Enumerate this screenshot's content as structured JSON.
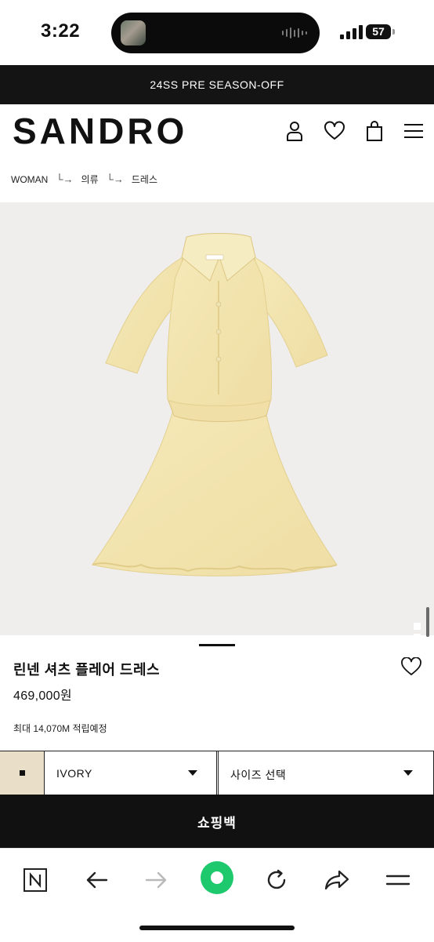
{
  "status_bar": {
    "time": "3:22",
    "battery": "57"
  },
  "promo": {
    "text": "24SS PRE SEASON-OFF"
  },
  "header": {
    "logo": "SANDRO",
    "icons": [
      "user-icon",
      "heart-icon",
      "shopping-bag-icon",
      "menu-icon"
    ]
  },
  "breadcrumb": {
    "items": [
      "WOMAN",
      "의류",
      "드레스"
    ],
    "separator": "└→"
  },
  "gallery": {
    "total": 7,
    "active": 7
  },
  "product": {
    "name": "린넨 셔츠 플레어 드레스",
    "price": "469,000원",
    "points": "최대 14,070M 적립예정"
  },
  "options": {
    "color_value": "IVORY",
    "swatch_color": "#e9dfc9",
    "size_placeholder": "사이즈 선택"
  },
  "cart_button": {
    "label": "쇼핑백"
  },
  "browser_toolbar": {
    "items": [
      "naver-n-icon",
      "back-arrow-icon",
      "forward-arrow-icon",
      "green-dot-icon",
      "refresh-icon",
      "share-icon",
      "menu-icon"
    ],
    "accent": "#1ec86d"
  }
}
